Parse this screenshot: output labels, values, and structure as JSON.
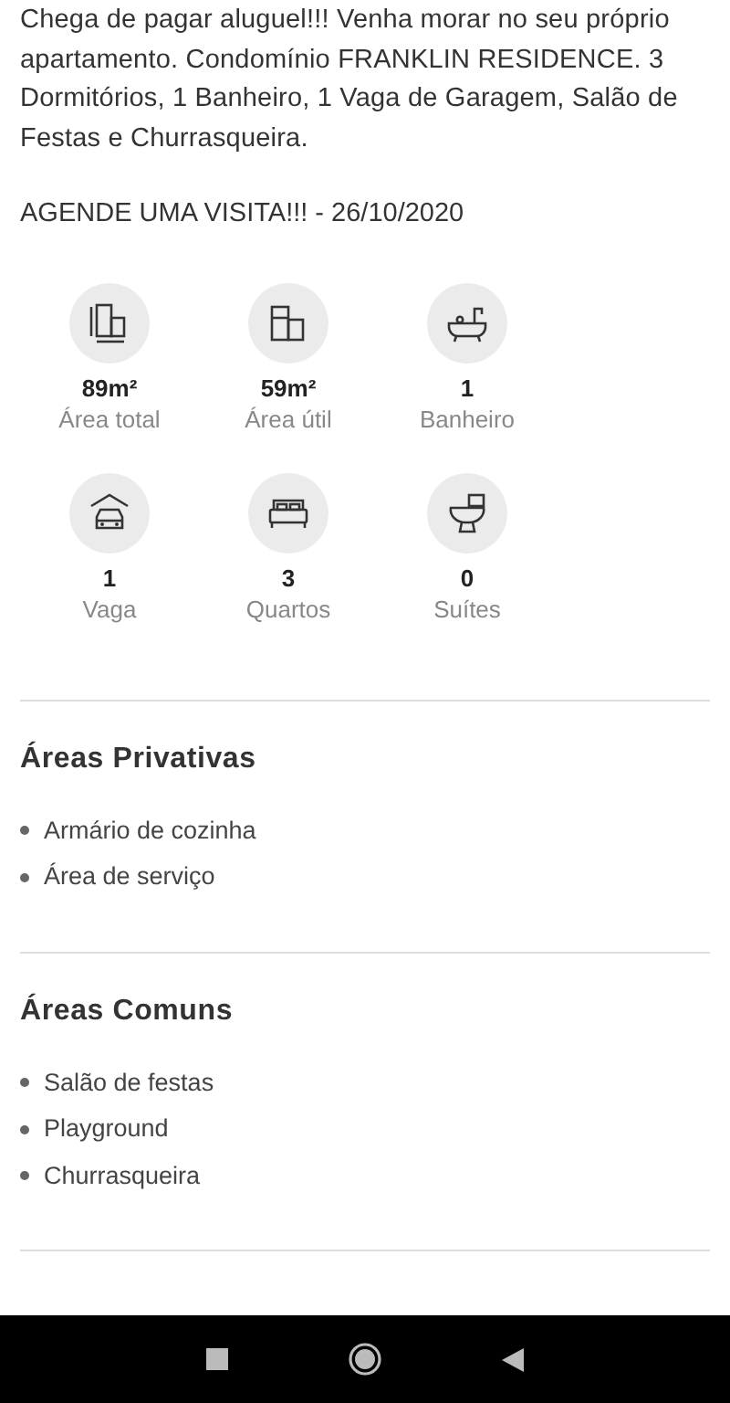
{
  "description": "Chega de pagar aluguel!!! Venha morar no seu próprio apartamento. Condomínio FRANKLIN RESIDENCE. 3 Dormitórios, 1 Banheiro, 1 Vaga de Garagem, Salão de Festas e Churrasqueira.",
  "visit_line": "AGENDE UMA VISITA!!! - 26/10/2020",
  "features": [
    {
      "kind": "total-area",
      "value": "89m²",
      "label": "Área total"
    },
    {
      "kind": "useful-area",
      "value": "59m²",
      "label": "Área útil"
    },
    {
      "kind": "bathtub",
      "value": "1",
      "label": "Banheiro"
    },
    {
      "kind": "garage",
      "value": "1",
      "label": "Vaga"
    },
    {
      "kind": "bed",
      "value": "3",
      "label": "Quartos"
    },
    {
      "kind": "toilet",
      "value": "0",
      "label": "Suítes"
    }
  ],
  "sections": [
    {
      "title": "Áreas Privativas",
      "items": [
        "Armário de cozinha",
        "Área de serviço"
      ]
    },
    {
      "title": "Áreas Comuns",
      "items": [
        "Salão de festas",
        "Playground",
        "Churrasqueira"
      ]
    }
  ]
}
